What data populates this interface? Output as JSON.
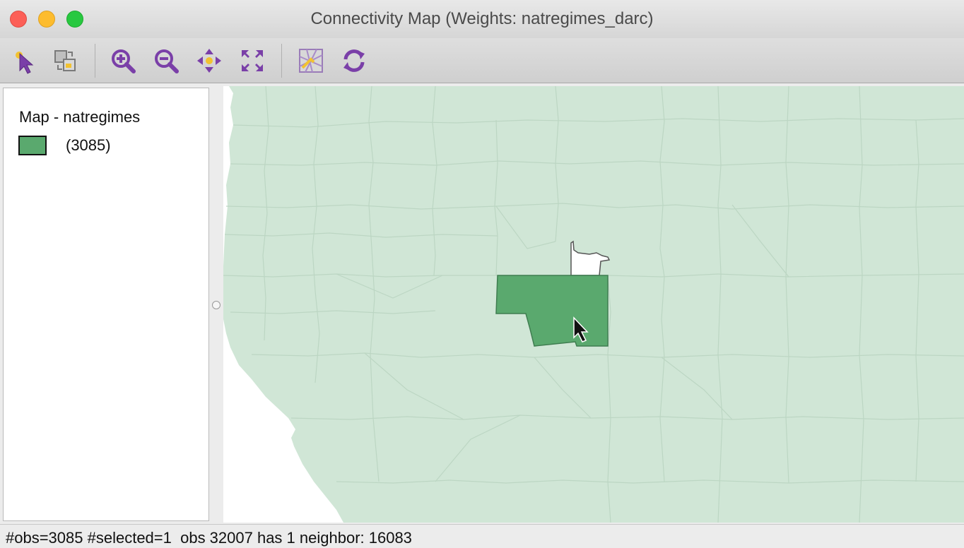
{
  "window": {
    "title": "Connectivity Map (Weights: natregimes_darc)"
  },
  "toolbar": {
    "buttons": [
      {
        "name": "select-tool",
        "icon": "select-arrow-icon"
      },
      {
        "name": "selection-mode",
        "icon": "selection-mode-icon"
      },
      {
        "name": "zoom-in",
        "icon": "zoom-in-icon"
      },
      {
        "name": "zoom-out",
        "icon": "zoom-out-icon"
      },
      {
        "name": "pan",
        "icon": "pan-icon"
      },
      {
        "name": "fit-to-window",
        "icon": "fit-to-window-icon"
      },
      {
        "name": "basemap",
        "icon": "basemap-icon"
      },
      {
        "name": "refresh",
        "icon": "refresh-icon"
      }
    ],
    "accent_color": "#7a3fa8"
  },
  "legend": {
    "title": "Map - natregimes",
    "items": [
      {
        "label": "(3085)",
        "color": "#5aa96e"
      }
    ]
  },
  "map": {
    "base_fill": "#d0e6d6",
    "boundary_color": "#bcd6c3",
    "selected_fill": "#5aa96e",
    "neighbor_fill": "#ffffff"
  },
  "status": {
    "text": "#obs=3085 #selected=1  obs 32007 has 1 neighbor: 16083"
  }
}
